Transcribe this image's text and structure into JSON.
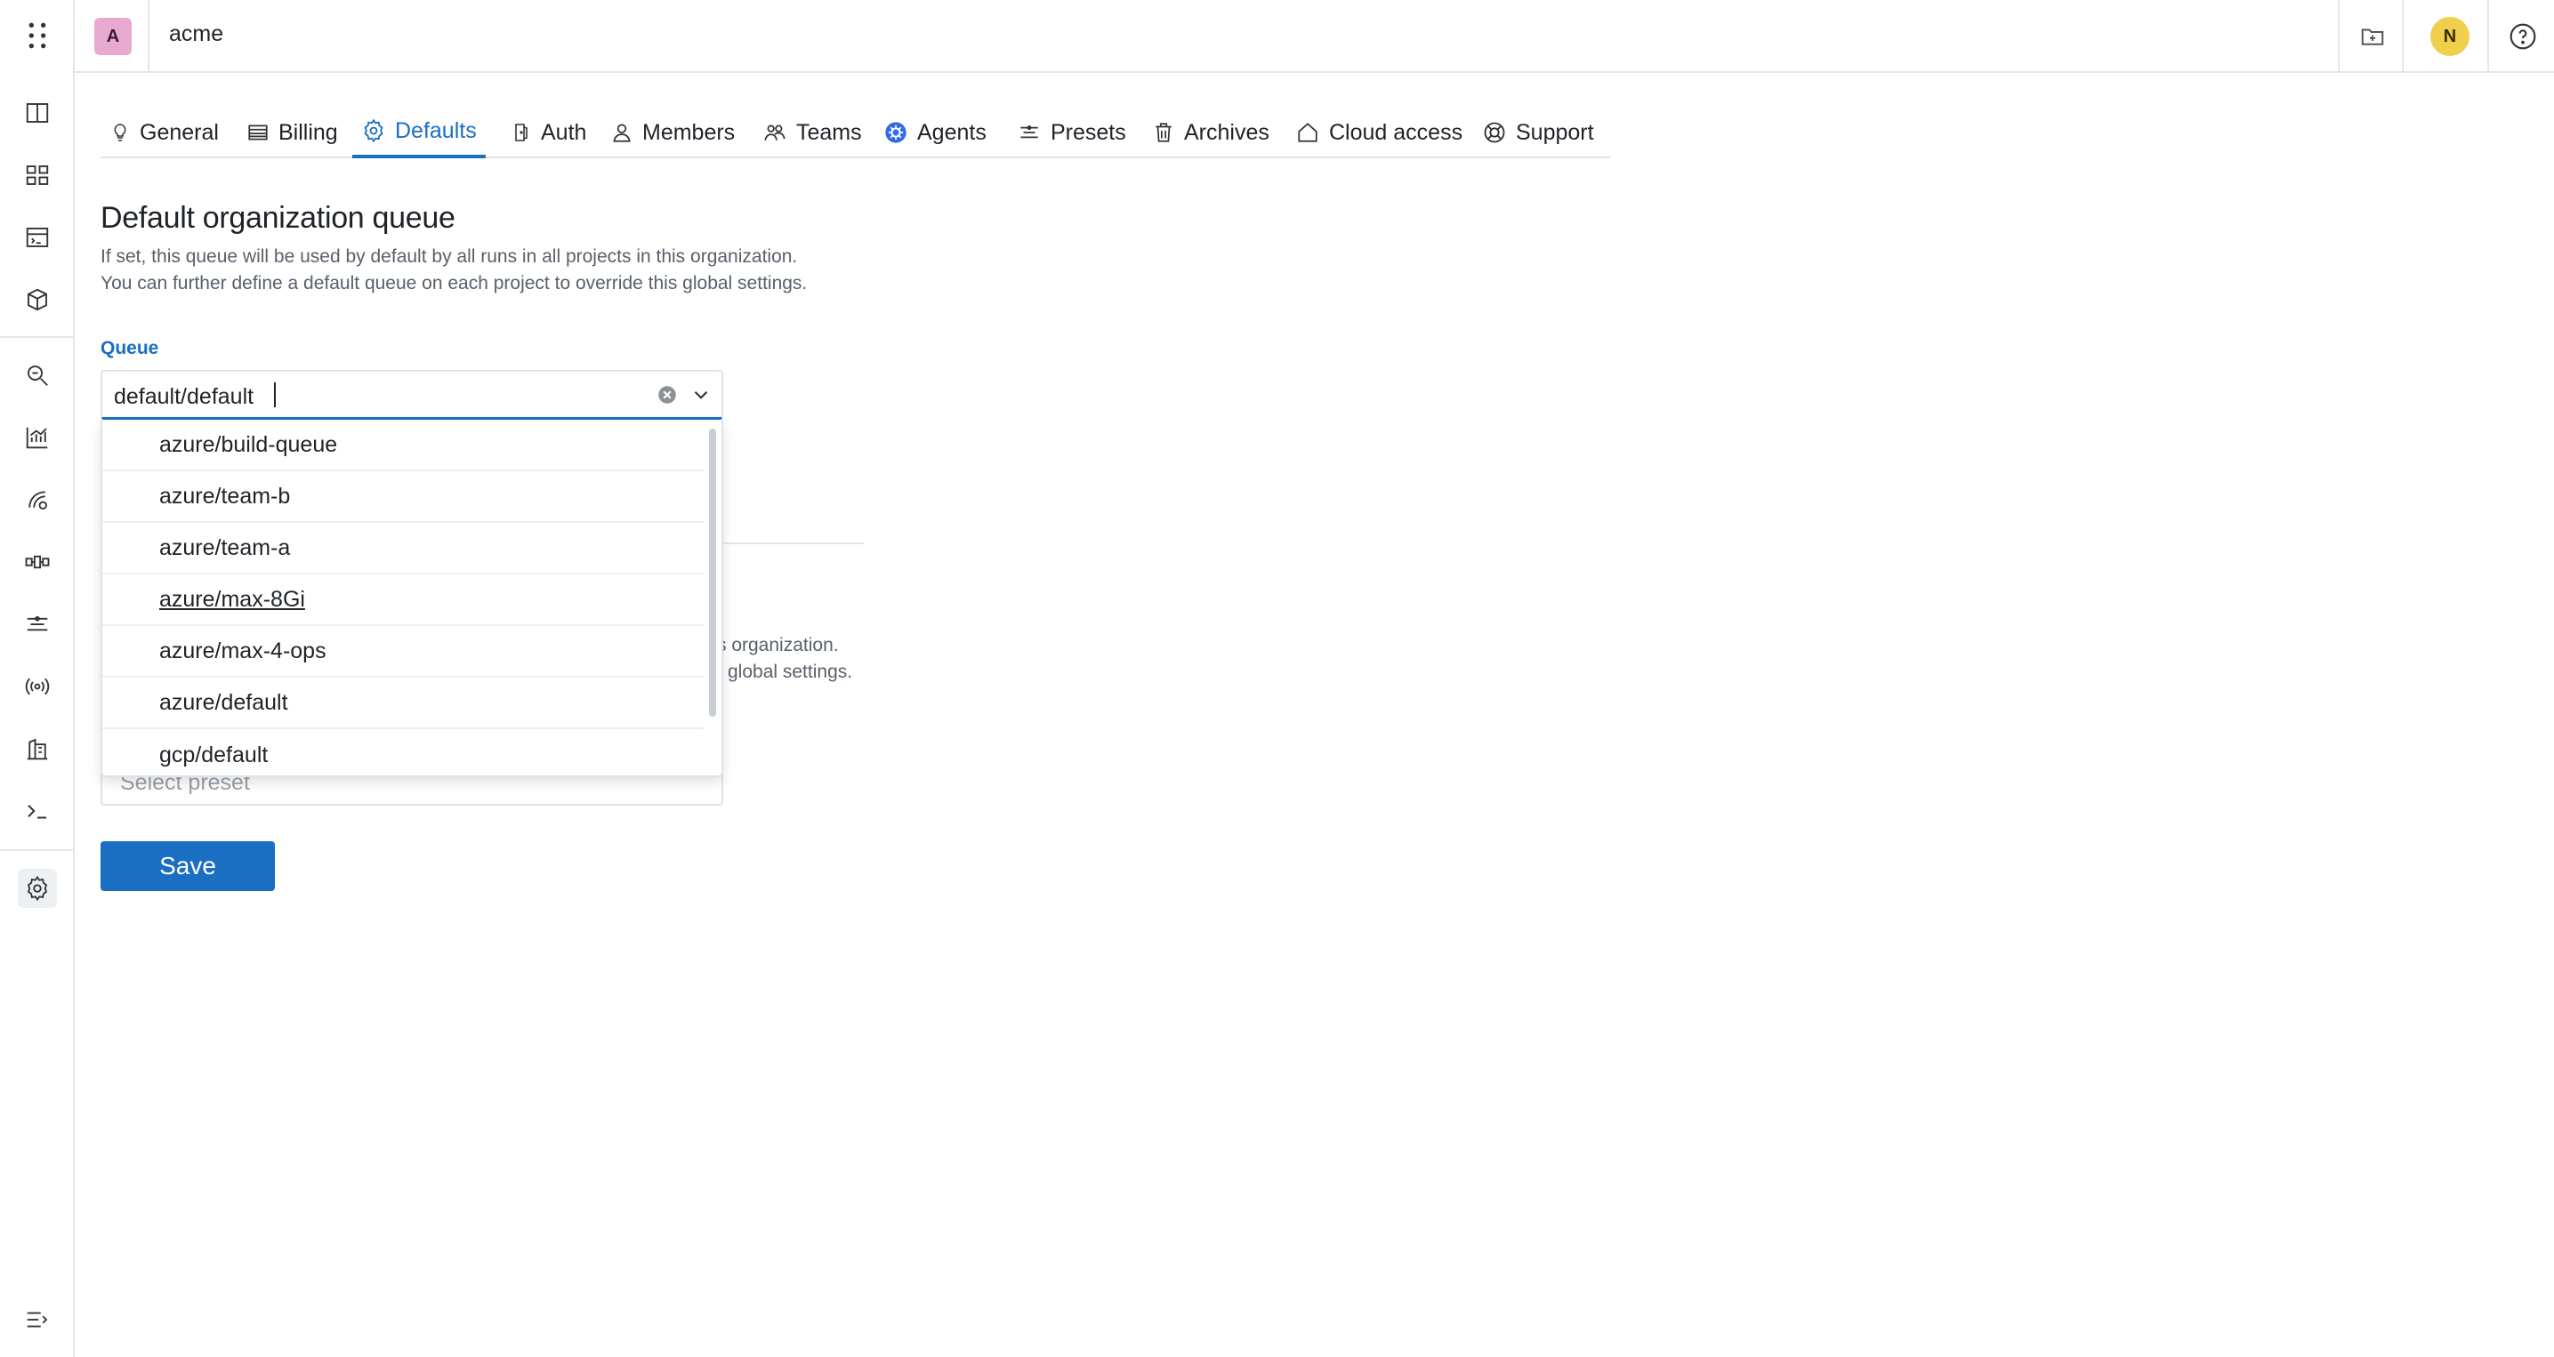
{
  "header": {
    "org_initial": "A",
    "org_name": "acme",
    "user_initial": "N"
  },
  "sidebar": {
    "icons": [
      "columns-icon",
      "dashboard-icon",
      "runs-icon",
      "cube-icon",
      "search-icon",
      "chart-icon",
      "lineage-icon",
      "pipeline-icon",
      "presets-icon",
      "broadcast-icon",
      "building-icon",
      "terminal-icon",
      "settings-icon",
      "collapse-icon"
    ]
  },
  "tabs": [
    {
      "label": "General",
      "icon": "lightbulb-icon"
    },
    {
      "label": "Billing",
      "icon": "billing-icon"
    },
    {
      "label": "Defaults",
      "icon": "gear-icon",
      "active": true
    },
    {
      "label": "Auth",
      "icon": "auth-icon"
    },
    {
      "label": "Members",
      "icon": "member-icon"
    },
    {
      "label": "Teams",
      "icon": "teams-icon"
    },
    {
      "label": "Agents",
      "icon": "kubernetes-icon"
    },
    {
      "label": "Presets",
      "icon": "presets-icon"
    },
    {
      "label": "Archives",
      "icon": "trash-icon"
    },
    {
      "label": "Cloud access",
      "icon": "home-icon"
    },
    {
      "label": "Support",
      "icon": "lifebuoy-icon"
    }
  ],
  "main": {
    "title": "Default organization queue",
    "description_line1": "If set, this queue will be used by default by all runs in all projects in this organization.",
    "description_line2": "You can further define a default queue on each project to override this global settings.",
    "queue_label": "Queue",
    "queue_value": "default/default",
    "options": [
      "azure/build-queue",
      "azure/team-b",
      "azure/team-a",
      "azure/max-8Gi",
      "azure/max-4-ops",
      "azure/default",
      "gcp/default"
    ],
    "hovered_option": "azure/max-8Gi",
    "ghost_desc1_fragment": "s organization.",
    "ghost_desc2_fragment": "global settings.",
    "preset_placeholder": "Select preset",
    "save_label": "Save"
  },
  "colors": {
    "accent": "#1a6fc2",
    "org_badge": "#e8a9d0",
    "avatar": "#f0cf4c"
  }
}
